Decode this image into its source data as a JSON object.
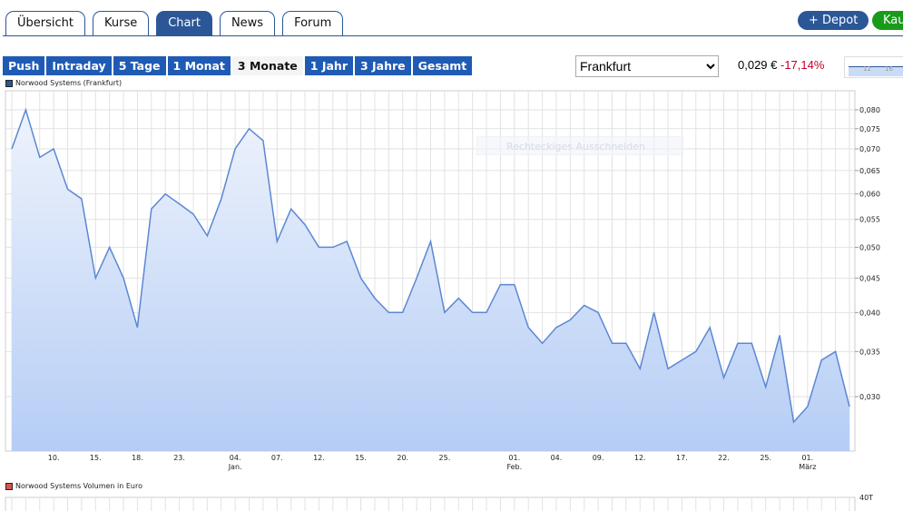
{
  "tabs": [
    {
      "label": "Übersicht"
    },
    {
      "label": "Kurse"
    },
    {
      "label": "Chart",
      "active": true
    },
    {
      "label": "News"
    },
    {
      "label": "Forum"
    }
  ],
  "actions": {
    "depot": "+ Depot",
    "kaufen": "Kau"
  },
  "ranges": [
    {
      "label": "Push"
    },
    {
      "label": "Intraday"
    },
    {
      "label": "5 Tage"
    },
    {
      "label": "1 Monat"
    },
    {
      "label": "3 Monate",
      "selected": true
    },
    {
      "label": "1 Jahr"
    },
    {
      "label": "3 Jahre"
    },
    {
      "label": "Gesamt"
    }
  ],
  "exchange": {
    "selected": "Frankfurt"
  },
  "quote": {
    "price": "0,029 €",
    "change": "-17,14%",
    "change_color": "#c0002a"
  },
  "minimap": {
    "labels": [
      "12",
      "16"
    ]
  },
  "overlay": {
    "text": "Rechteckiges Ausschneiden"
  },
  "colors": {
    "accent": "#2b5797",
    "button": "#1f5bb5",
    "buy": "#1a9a1a",
    "line": "#5b87d4",
    "volume_legend": "#d9534f"
  },
  "chart_data": {
    "type": "area",
    "series": [
      {
        "name": "Norwood Systems (Frankfurt)",
        "values": [
          0.07,
          0.08,
          0.068,
          0.07,
          0.061,
          0.059,
          0.045,
          0.05,
          0.045,
          0.038,
          0.057,
          0.06,
          0.058,
          0.056,
          0.052,
          0.059,
          0.07,
          0.075,
          0.072,
          0.051,
          0.057,
          0.054,
          0.05,
          0.05,
          0.051,
          0.045,
          0.042,
          0.04,
          0.04,
          0.045,
          0.051,
          0.04,
          0.042,
          0.04,
          0.04,
          0.044,
          0.044,
          0.038,
          0.036,
          0.038,
          0.039,
          0.041,
          0.04,
          0.036,
          0.036,
          0.033,
          0.04,
          0.033,
          0.034,
          0.035,
          0.038,
          0.032,
          0.036,
          0.036,
          0.031,
          0.037,
          0.0275,
          0.029,
          0.034,
          0.035,
          0.029
        ]
      }
    ],
    "y_scale": "log",
    "y_ticks": [
      "0,080",
      "0,075",
      "0,070",
      "0,065",
      "0,060",
      "0,055",
      "0,050",
      "0,045",
      "0,040",
      "0,035",
      "0,030"
    ],
    "y_tick_values": [
      0.08,
      0.075,
      0.07,
      0.065,
      0.06,
      0.055,
      0.05,
      0.045,
      0.04,
      0.035,
      0.03
    ],
    "x_ticks": [
      {
        "label": "10.",
        "index": 3
      },
      {
        "label": "15.",
        "index": 6
      },
      {
        "label": "18.",
        "index": 9
      },
      {
        "label": "23.",
        "index": 12
      },
      {
        "label": "04.",
        "sub": "Jan.",
        "index": 16
      },
      {
        "label": "07.",
        "index": 19
      },
      {
        "label": "12.",
        "index": 22
      },
      {
        "label": "15.",
        "index": 25
      },
      {
        "label": "20.",
        "index": 28
      },
      {
        "label": "25.",
        "index": 31
      },
      {
        "label": "01.",
        "sub": "Feb.",
        "index": 36
      },
      {
        "label": "04.",
        "index": 39
      },
      {
        "label": "09.",
        "index": 42
      },
      {
        "label": "12.",
        "index": 45
      },
      {
        "label": "17.",
        "index": 48
      },
      {
        "label": "22.",
        "index": 51
      },
      {
        "label": "25.",
        "index": 54
      },
      {
        "label": "01.",
        "sub": "März",
        "index": 57
      }
    ],
    "grid": true
  },
  "volume": {
    "legend": "Norwood Systems Volumen in Euro",
    "y_tick": "40T"
  }
}
